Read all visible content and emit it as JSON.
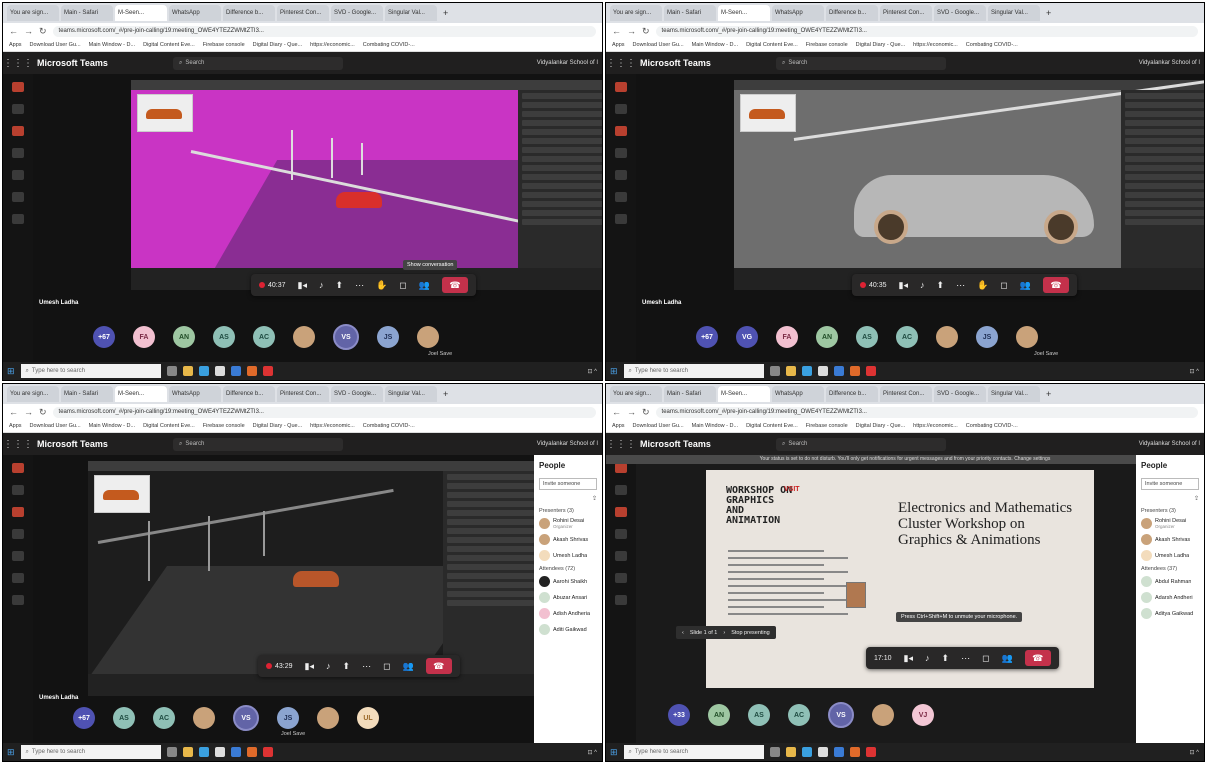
{
  "browser": {
    "tabs": [
      "You are sign...",
      "Main - Safari",
      "M-Seen...",
      "WhatsApp",
      "Difference b...",
      "Pinterest Con...",
      "SVD - Google...",
      "Singular Val..."
    ],
    "url": "teams.microsoft.com/_#/pre-join-calling/19:meeting_OWE4YTEZZWMtZTI3MC00MzdgLWI1OGMtNDcxNzBkOTkzNzBh@thread.v2",
    "url_short": "teams.microsoft.com/_#/pre-join-calling/19:meeting_OWE4YTEZZWMtZTI3...",
    "bookmarks": [
      "Apps",
      "Download User Gu...",
      "Main Window - D...",
      "Digital Content Eve...",
      "Firebase console",
      "Digital Diary - Que...",
      "https://economic...",
      "Combating COVID-..."
    ]
  },
  "teams": {
    "app_name": "Microsoft Teams",
    "search_placeholder": "Search",
    "org": "Vidyalankar School of I",
    "presenter": "Umesh Ladha",
    "others_count": "+67",
    "others_count_4": "+33",
    "joel": "Joel Save",
    "timers": [
      "40:37",
      "40:35",
      "43:29",
      "17:10"
    ],
    "tooltip_conversation": "Show conversation",
    "mic_tip": "Press Ctrl+Shift+M to unmute your microphone."
  },
  "avatars": {
    "p1": [
      "FA",
      "AN",
      "AS",
      "AC",
      "VS",
      "JS"
    ],
    "p2": [
      "VG",
      "FA",
      "AN",
      "AS",
      "AC",
      "JS"
    ],
    "p3": [
      "AS",
      "AC",
      "VS",
      "JS",
      "UL"
    ],
    "p4": [
      "AN",
      "AS",
      "AC",
      "VS",
      "VJ"
    ]
  },
  "people": {
    "title": "People",
    "invite": "Invite someone",
    "presenters": "Presenters (3)",
    "attendees": "Attendees (72)",
    "attendees_4": "Attendees (37)",
    "presenter_list": [
      "Rohini Desai",
      "Akash Shrivas",
      "Umesh Ladha"
    ],
    "organizer": "Organizer",
    "attendee_list": [
      "Aarohi Shaikh",
      "Abuzar Ansari",
      "Adish Andheria",
      "Aditi Gaikwad"
    ],
    "attendee_list_4": [
      "Abdul Rahman",
      "Adarsh Andheri",
      "Aditya Gaikwad"
    ]
  },
  "slide": {
    "left_title": "WORKSHOP ON GRAPHICS AND ANIMATION",
    "brand": "VSIT",
    "main_title": "Electronics and Mathematics Cluster Workshop on Graphics & Animations",
    "nav": "Slide 1 of 1",
    "stop": "Stop presenting",
    "notice": "Your status is set to do not disturb. You'll only get notifications for urgent messages and from your priority contacts. Change settings"
  },
  "taskbar": {
    "search": "Type here to search"
  }
}
